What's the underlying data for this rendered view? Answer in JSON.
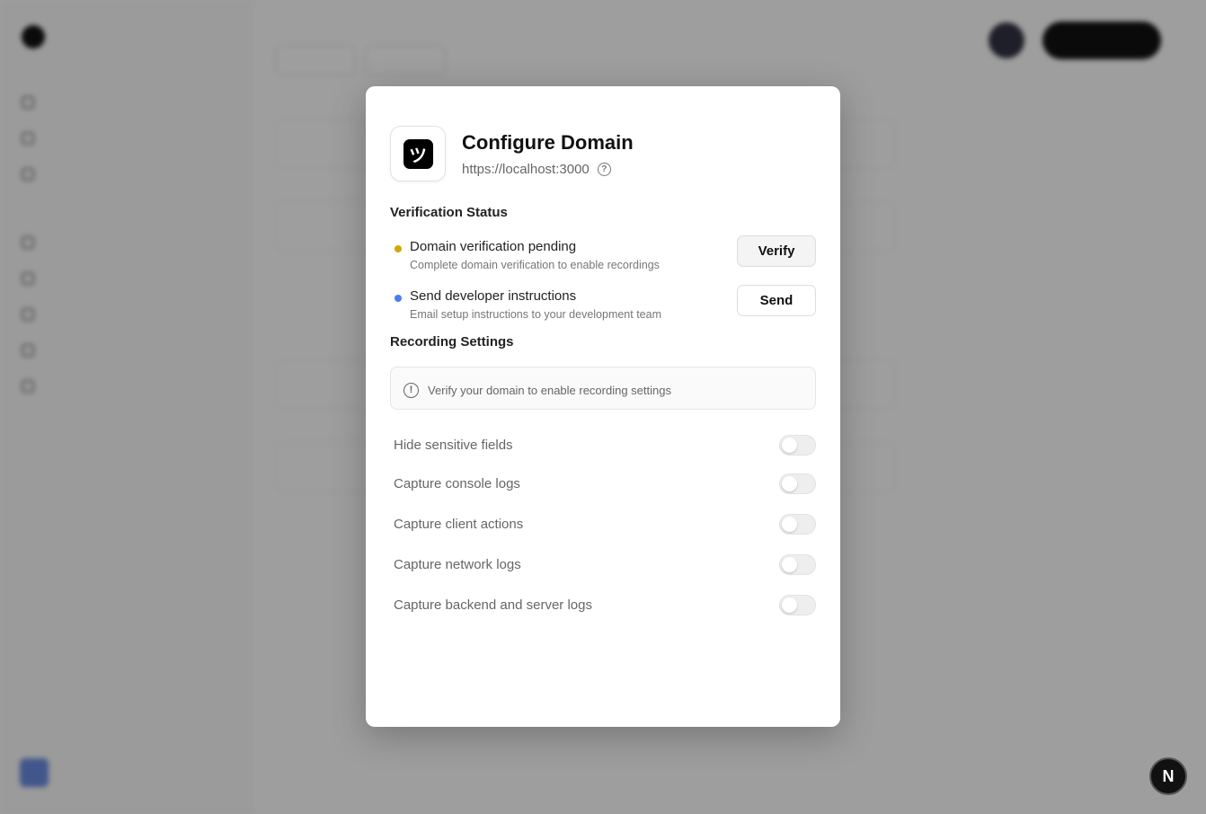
{
  "modal": {
    "title": "Configure Domain",
    "url": "https://localhost:3000",
    "app_icon_glyph": "ツ",
    "verification": {
      "title": "Verification Status",
      "tasks": [
        {
          "title": "Domain verification pending",
          "description": "Complete domain verification to enable recordings",
          "button": "Verify",
          "dot_color": "#d4a800"
        },
        {
          "title": "Send developer instructions",
          "description": "Email setup instructions to your development team",
          "button": "Send",
          "dot_color": "#4a7df0"
        }
      ]
    },
    "recording": {
      "title": "Recording Settings",
      "notice": "Verify your domain to enable recording settings",
      "settings": [
        {
          "label": "Hide sensitive fields",
          "enabled": false
        },
        {
          "label": "Capture console logs",
          "enabled": false
        },
        {
          "label": "Capture client actions",
          "enabled": false
        },
        {
          "label": "Capture network logs",
          "enabled": false
        },
        {
          "label": "Capture backend and server logs",
          "enabled": false
        }
      ]
    }
  },
  "badge": {
    "label": "N"
  }
}
